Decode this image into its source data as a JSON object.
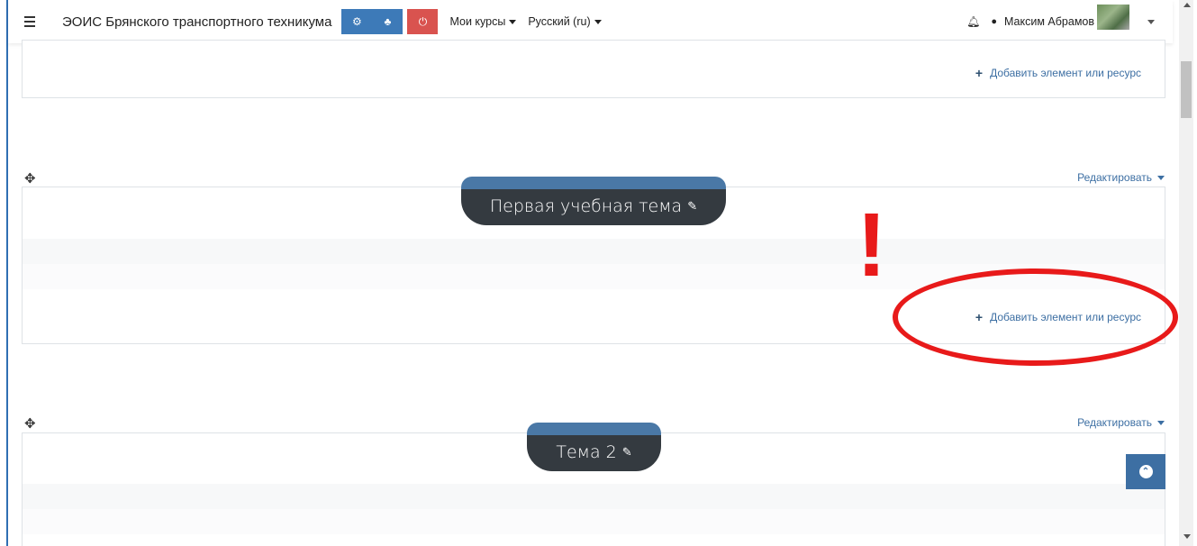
{
  "navbar": {
    "site_name": "ЭОИС Брянского транспортного техникума",
    "my_courses": "Мои курсы",
    "language": "Русский (ru)",
    "user_name": "Максим Абрамов",
    "icons": [
      "hamburger-icon",
      "cogs-icon",
      "sitemap-icon",
      "power-icon",
      "bell-icon",
      "chat-icon"
    ]
  },
  "top_section": {
    "add_label": "Добавить элемент или ресурс"
  },
  "sections": [
    {
      "title": "Первая учебная тема",
      "edit_label": "Редактировать",
      "add_label": "Добавить элемент или ресурс"
    },
    {
      "title": "Тема 2",
      "edit_label": "Редактировать"
    }
  ],
  "annotation": {
    "mark": "!",
    "color": "#e81a1a"
  },
  "colors": {
    "accent": "#3d7ab8",
    "danger": "#d9534f",
    "title_bg": "#343a40",
    "link": "#3d6fa3"
  }
}
